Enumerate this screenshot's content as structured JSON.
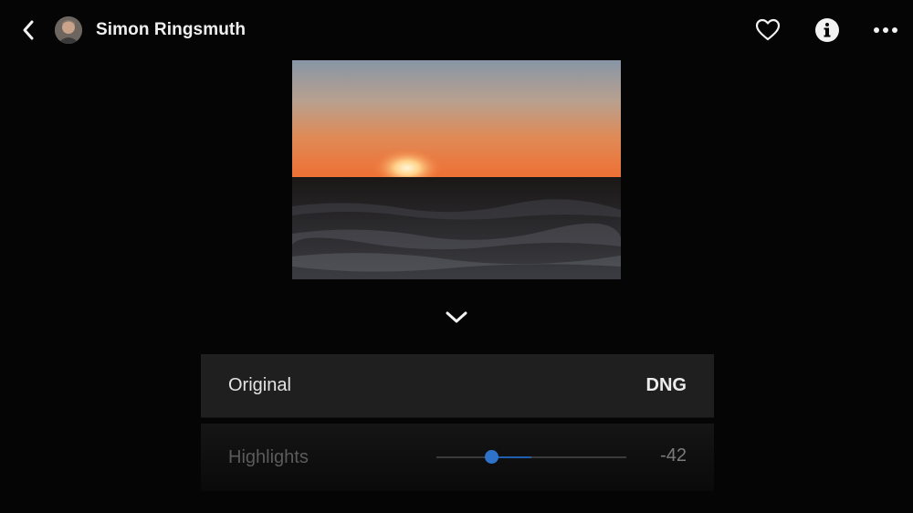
{
  "header": {
    "user_name": "Simon Ringsmuth"
  },
  "icons": {
    "back": "chevron-left-icon",
    "avatar": "avatar",
    "favorite": "heart-icon",
    "info": "info-icon",
    "more": "more-icon",
    "expand": "chevron-down-icon"
  },
  "panel": {
    "original_label": "Original",
    "original_value": "DNG",
    "highlights_label": "Highlights",
    "highlights_value": "-42",
    "highlights_level": -42,
    "highlights_range": [
      -100,
      100
    ]
  },
  "colors": {
    "accent": "#2e73c9",
    "background": "#050505",
    "panel": "#1f1f1f"
  }
}
